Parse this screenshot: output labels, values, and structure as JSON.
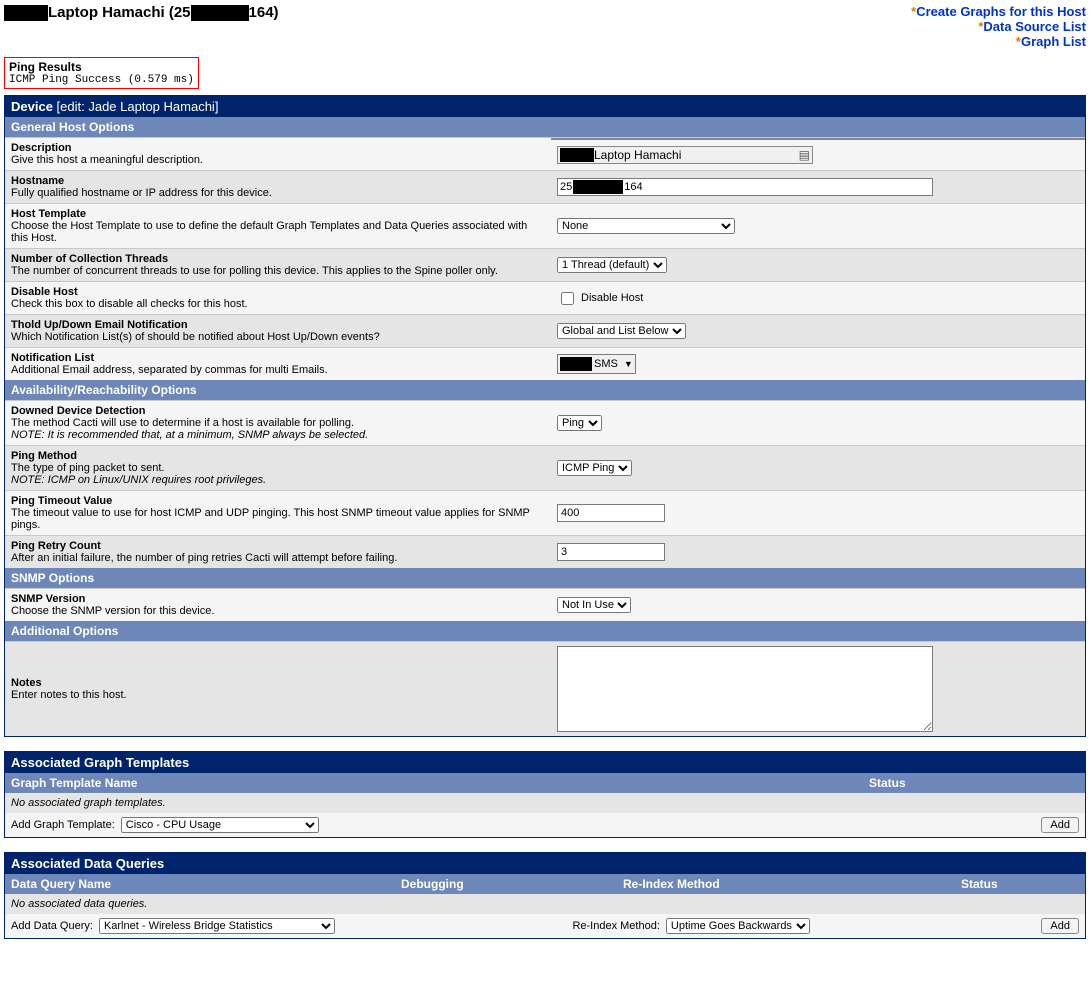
{
  "header": {
    "title_suffix": " Laptop Hamachi (25",
    "title_ip_tail": "164)",
    "links": {
      "create_graphs": "Create Graphs for this Host",
      "data_source_list": "Data Source List",
      "graph_list": "Graph List"
    }
  },
  "ping": {
    "title": "Ping Results",
    "status": "ICMP Ping Success (0.579 ms)"
  },
  "device_panel": {
    "heading_prefix": "Device ",
    "heading_edit": "[edit: Jade Laptop Hamachi]"
  },
  "sections": {
    "general": "General Host Options",
    "availability": "Availability/Reachability Options",
    "snmp": "SNMP Options",
    "additional": "Additional Options"
  },
  "fields": {
    "description": {
      "label": "Description",
      "desc": "Give this host a meaningful description.",
      "value": " Laptop Hamachi"
    },
    "hostname": {
      "label": "Hostname",
      "desc": "Fully qualified hostname or IP address for this device.",
      "prefix": "25",
      "suffix": "164"
    },
    "host_template": {
      "label": "Host Template",
      "desc": "Choose the Host Template to use to define the default Graph Templates and Data Queries associated with this Host.",
      "value": "None"
    },
    "threads": {
      "label": "Number of Collection Threads",
      "desc": "The number of concurrent threads to use for polling this device. This applies to the Spine poller only.",
      "value": "1 Thread (default)"
    },
    "disable": {
      "label": "Disable Host",
      "desc": "Check this box to disable all checks for this host.",
      "checkbox_label": "Disable Host"
    },
    "thold": {
      "label": "Thold Up/Down Email Notification",
      "desc": "Which Notification List(s) of should be notified about Host Up/Down events?",
      "value": "Global and List Below"
    },
    "notif": {
      "label": "Notification List",
      "desc": "Additional Email address, separated by commas for multi Emails.",
      "value": "SMS"
    },
    "downed": {
      "label": "Downed Device Detection",
      "desc": "The method Cacti will use to determine if a host is available for polling.",
      "note": "NOTE: It is recommended that, at a minimum, SNMP always be selected.",
      "value": "Ping"
    },
    "ping_method": {
      "label": "Ping Method",
      "desc": "The type of ping packet to sent.",
      "note": "NOTE: ICMP on Linux/UNIX requires root privileges.",
      "value": "ICMP Ping"
    },
    "ping_timeout": {
      "label": "Ping Timeout Value",
      "desc": "The timeout value to use for host ICMP and UDP pinging. This host SNMP timeout value applies for SNMP pings.",
      "value": "400"
    },
    "ping_retry": {
      "label": "Ping Retry Count",
      "desc": "After an initial failure, the number of ping retries Cacti will attempt before failing.",
      "value": "3"
    },
    "snmp_version": {
      "label": "SNMP Version",
      "desc": "Choose the SNMP version for this device.",
      "value": "Not In Use"
    },
    "notes": {
      "label": "Notes",
      "desc": "Enter notes to this host."
    }
  },
  "graph_templates": {
    "heading": "Associated Graph Templates",
    "col_name": "Graph Template Name",
    "col_status": "Status",
    "empty": "No associated graph templates.",
    "add_label": "Add Graph Template:",
    "add_value": "Cisco - CPU Usage",
    "add_button": "Add"
  },
  "data_queries": {
    "heading": "Associated Data Queries",
    "col_name": "Data Query Name",
    "col_debug": "Debugging",
    "col_reindex": "Re-Index Method",
    "col_status": "Status",
    "empty": "No associated data queries.",
    "add_label": "Add Data Query:",
    "add_value": "Karlnet - Wireless Bridge Statistics",
    "reindex_label": "Re-Index Method:",
    "reindex_value": "Uptime Goes Backwards",
    "add_button": "Add"
  }
}
